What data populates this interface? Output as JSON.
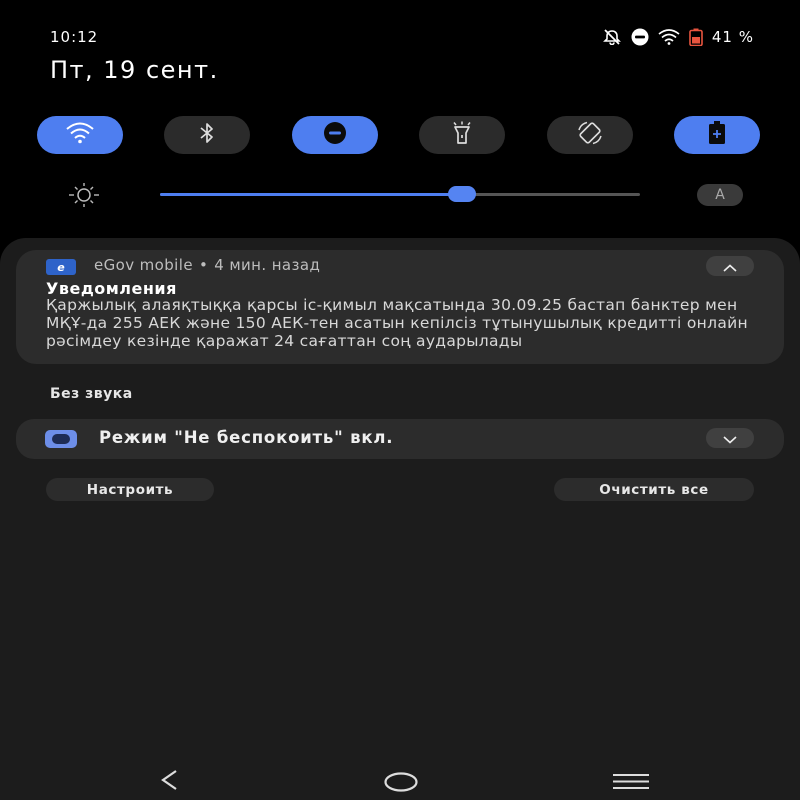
{
  "status_bar": {
    "time": "10:12",
    "battery_percent": "41 %",
    "icons": [
      "mute-icon",
      "dnd-status-icon",
      "wifi-status-icon",
      "battery-saver-icon"
    ]
  },
  "date": "Пт, 19 сент.",
  "quick_settings": {
    "tiles": [
      {
        "name": "wifi",
        "icon": "wifi-icon",
        "active": true
      },
      {
        "name": "bluetooth",
        "icon": "bluetooth-icon",
        "active": false
      },
      {
        "name": "do-not-disturb",
        "icon": "dnd-icon",
        "active": true
      },
      {
        "name": "flashlight",
        "icon": "flashlight-icon",
        "active": false
      },
      {
        "name": "auto-rotate",
        "icon": "rotate-icon",
        "active": false
      },
      {
        "name": "battery-saver",
        "icon": "battery-saver-icon",
        "active": true
      }
    ],
    "brightness_level": 0.63,
    "auto_brightness_label": "A"
  },
  "notification": {
    "app_icon_text": "e",
    "app_name": "eGov mobile",
    "separator": "•",
    "time_ago": "4 мин. назад",
    "title": "Уведомления",
    "body": "Қаржылық алаяқтыққа қарсы іс-қимыл мақсатында 30.09.25 бастап банктер мен МҚҰ-да 255 АЕК және 150 АЕК-тен асатын кепілсіз тұтынушылық кредитті онлайн рәсімдеу кезінде қаражат 24 сағаттан соң аударылады"
  },
  "silent_section_label": "Без звука",
  "dnd_notification": {
    "label": "Режим \"Не беспокоить\" вкл."
  },
  "buttons": {
    "configure": "Настроить",
    "clear_all": "Очистить все"
  },
  "colors": {
    "accent": "#4e7ef0",
    "background": "#000000",
    "panel": "#1c1c1c",
    "card": "#2c2c2c"
  }
}
